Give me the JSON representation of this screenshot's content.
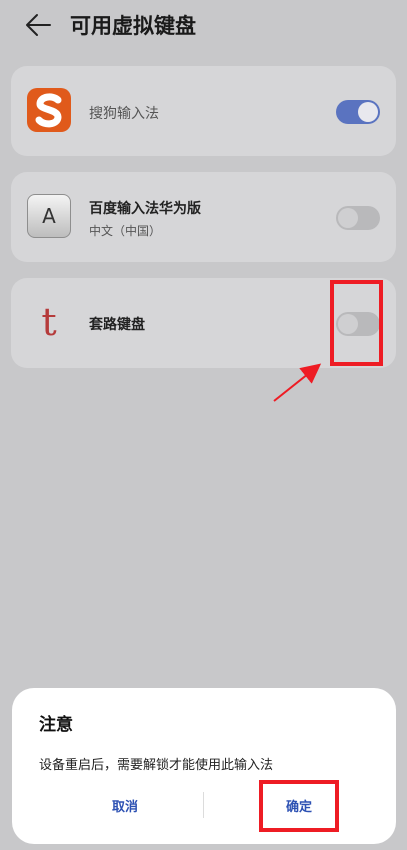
{
  "header": {
    "title": "可用虚拟键盘",
    "back_icon": "arrow-left-icon"
  },
  "keyboards": [
    {
      "name": "搜狗输入法",
      "subtitle": "",
      "enabled": true,
      "icon": "sogou-logo-icon",
      "icon_letter": "S",
      "icon_color": "#e05a1b"
    },
    {
      "name": "百度输入法华为版",
      "subtitle": "中文（中国）",
      "enabled": false,
      "icon": "baidu-keyboard-icon",
      "icon_letter": "A"
    },
    {
      "name": "套路键盘",
      "subtitle": "",
      "enabled": false,
      "icon": "t-logo-icon",
      "icon_letter": "t",
      "icon_color": "#b53b3b"
    }
  ],
  "dialog": {
    "title": "注意",
    "message": "设备重启后，需要解锁才能使用此输入法",
    "cancel_label": "取消",
    "confirm_label": "确定"
  },
  "colors": {
    "accent": "#2d51b3",
    "toggle_on": "#5a73c0",
    "annotation": "#ee1c24"
  }
}
